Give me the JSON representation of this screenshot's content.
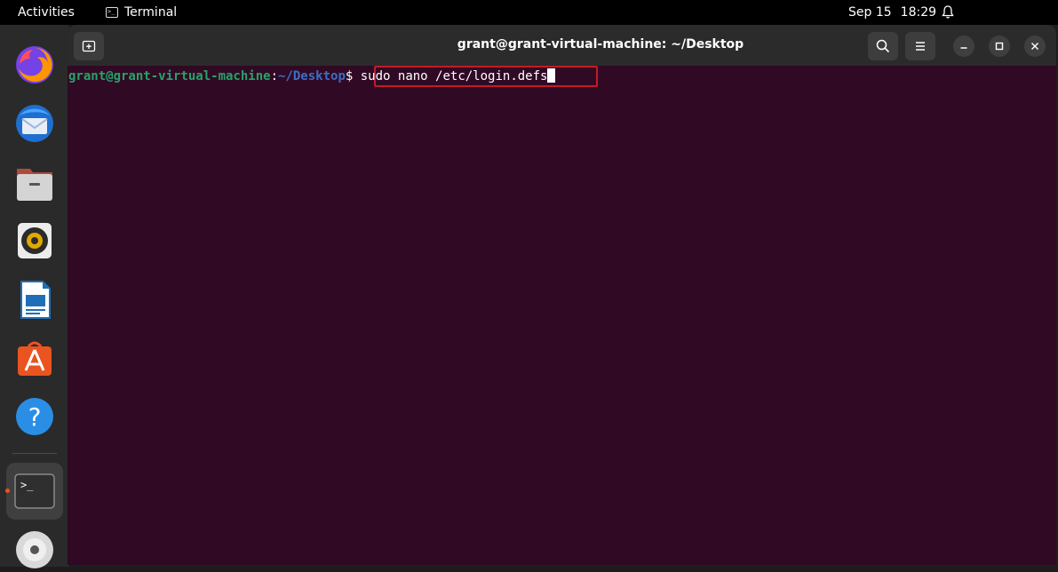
{
  "topbar": {
    "activities": "Activities",
    "app_name": "Terminal",
    "app_icon_glyph": ">_",
    "date": "Sep 15",
    "time": "18:29"
  },
  "dock": {
    "items": [
      {
        "name": "Firefox",
        "icon": "firefox-icon"
      },
      {
        "name": "Thunderbird",
        "icon": "thunderbird-icon"
      },
      {
        "name": "Files",
        "icon": "files-icon"
      },
      {
        "name": "Rhythmbox",
        "icon": "rhythmbox-icon"
      },
      {
        "name": "LibreOffice Writer",
        "icon": "writer-icon"
      },
      {
        "name": "Ubuntu Software",
        "icon": "software-icon"
      },
      {
        "name": "Help",
        "icon": "help-icon"
      },
      {
        "name": "Terminal",
        "icon": "terminal-icon",
        "active": true
      },
      {
        "name": "Disc",
        "icon": "disc-icon"
      }
    ],
    "terminal_glyph": ">_",
    "help_glyph": "?"
  },
  "window": {
    "title": "grant@grant-virtual-machine: ~/Desktop"
  },
  "terminal": {
    "prompt_user": "grant@grant-virtual-machine",
    "prompt_sep": ":",
    "prompt_path": "~/Desktop",
    "prompt_symbol": "$",
    "command": "sudo nano /etc/login.defs"
  },
  "colors": {
    "terminal_bg": "#300a24",
    "prompt_user": "#26a269",
    "prompt_path": "#3d6ec4",
    "highlight": "#c01c28",
    "accent": "#e95420"
  }
}
